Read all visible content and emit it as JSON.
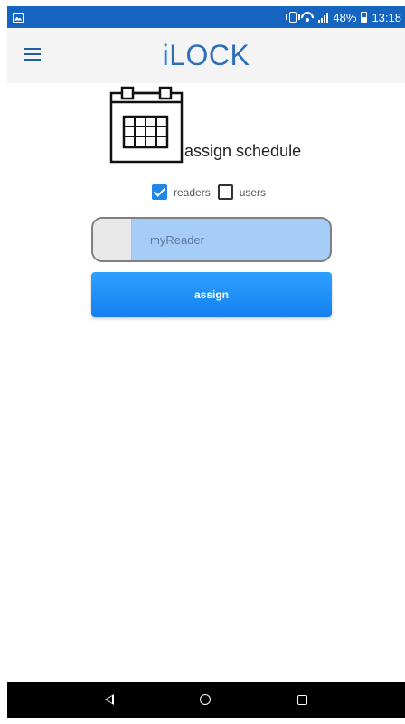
{
  "status_bar": {
    "battery_percent": "48%",
    "time": "13:18",
    "icons": [
      "photo-icon",
      "vibrate-icon",
      "wifi-icon",
      "signal-icon",
      "battery-icon"
    ]
  },
  "app_bar": {
    "title_i": "i",
    "title_rest": "LOCK",
    "menu_icon": "hamburger-menu-icon"
  },
  "content": {
    "calendar_icon": "calendar-icon",
    "label": "assign schedule",
    "checkboxes": [
      {
        "label": "readers",
        "checked": true
      },
      {
        "label": "users",
        "checked": false
      }
    ],
    "reader_field": {
      "value": "myReader"
    },
    "assign_button": "assign"
  },
  "nav_bar": {
    "icons": [
      "back-icon",
      "home-icon",
      "recents-icon"
    ]
  },
  "colors": {
    "status_bar": "#1565c0",
    "accent": "#1e88e5",
    "button": "#1a8cff",
    "field_fill": "#a6cdf8"
  }
}
